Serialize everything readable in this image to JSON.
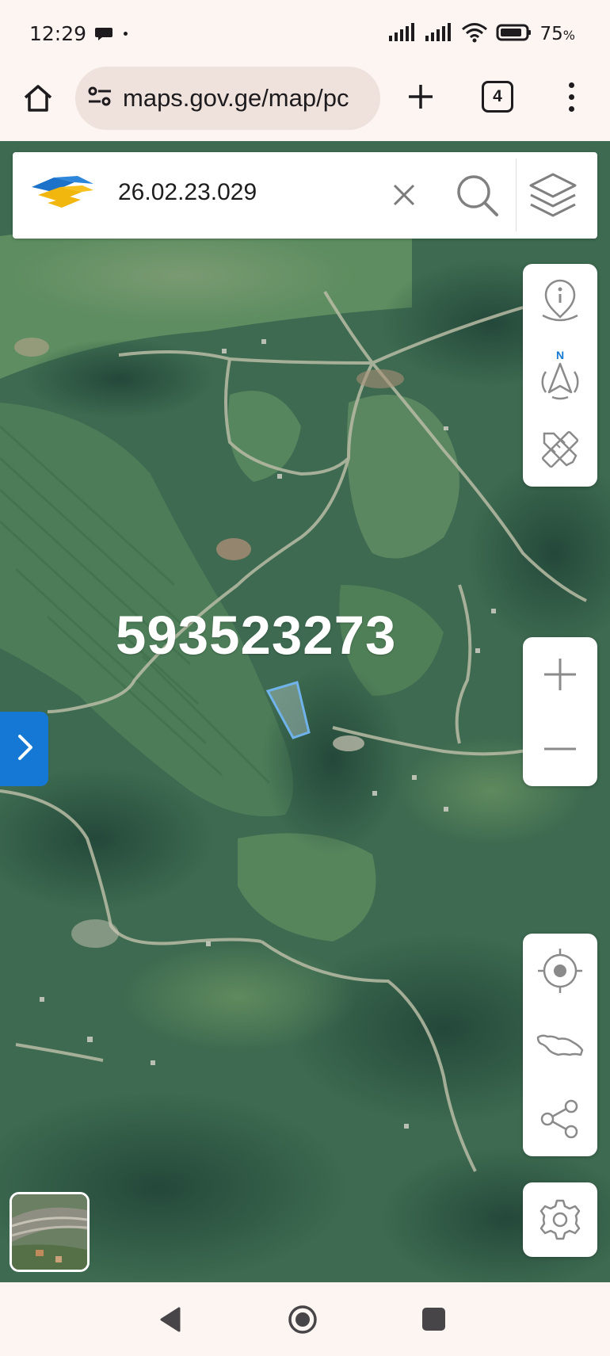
{
  "status_bar": {
    "time": "12:29",
    "battery_percent": "75",
    "battery_symbol": "%",
    "icons": [
      "message-bubble-icon",
      "signal-icon",
      "signal-icon",
      "wifi-icon",
      "battery-icon"
    ]
  },
  "browser": {
    "url": "maps.gov.ge/map/pc",
    "tab_count": "4",
    "icons": [
      "home-icon",
      "site-settings-icon",
      "plus-icon",
      "more-vert-icon"
    ]
  },
  "map": {
    "search_value": "26.02.23.029",
    "parcel_label": "593523273",
    "accent_color": "#1478d4",
    "parcel_outline_color": "#6fb3ea",
    "right_tools": [
      "info-icon",
      "compass-north-icon",
      "measure-icon",
      "zoom-in-icon",
      "zoom-out-icon",
      "locate-icon",
      "georgia-map-icon",
      "share-icon",
      "settings-icon"
    ],
    "compass_letter": "N"
  },
  "nav_bar": {
    "icons": [
      "back-icon",
      "home-circle-icon",
      "recents-icon"
    ]
  }
}
